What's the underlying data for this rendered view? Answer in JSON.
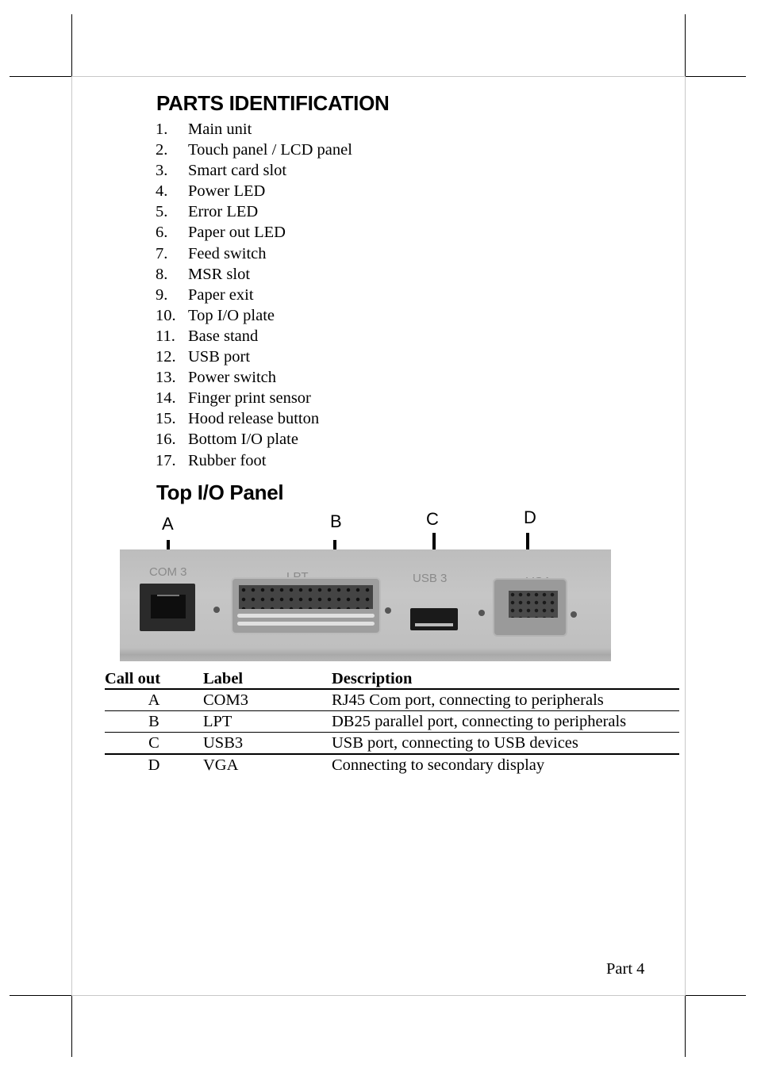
{
  "heading": "PARTS IDENTIFICATION",
  "parts": [
    {
      "num": "1.",
      "name": "Main unit"
    },
    {
      "num": "2.",
      "name": "Touch panel / LCD panel"
    },
    {
      "num": "3.",
      "name": "Smart card slot"
    },
    {
      "num": "4.",
      "name": "Power LED"
    },
    {
      "num": "5.",
      "name": "Error LED"
    },
    {
      "num": "6.",
      "name": "Paper out LED"
    },
    {
      "num": "7.",
      "name": "Feed switch"
    },
    {
      "num": "8.",
      "name": "MSR slot"
    },
    {
      "num": "9.",
      "name": "Paper exit"
    },
    {
      "num": "10.",
      "name": "Top I/O plate"
    },
    {
      "num": "11.",
      "name": "Base stand"
    },
    {
      "num": "12.",
      "name": "USB port"
    },
    {
      "num": "13.",
      "name": "Power switch"
    },
    {
      "num": "14.",
      "name": "Finger print sensor"
    },
    {
      "num": "15.",
      "name": "Hood release button"
    },
    {
      "num": "16.",
      "name": "Bottom I/O plate"
    },
    {
      "num": "17.",
      "name": "Rubber foot"
    }
  ],
  "io_panel": {
    "heading": "Top I/O Panel",
    "callouts": [
      "A",
      "B",
      "C",
      "D"
    ],
    "photo_labels": {
      "com": "COM 3",
      "lpt": "LPT",
      "usb": "USB 3",
      "vga": "VGA"
    }
  },
  "table": {
    "headers": [
      "Call out",
      "Label",
      "Description"
    ],
    "rows": [
      {
        "callout": "A",
        "label": "COM3",
        "description": "RJ45 Com port, connecting to peripherals"
      },
      {
        "callout": "B",
        "label": "LPT",
        "description": "DB25 parallel port, connecting to peripherals"
      },
      {
        "callout": "C",
        "label": "USB3",
        "description": "USB port, connecting to USB devices"
      },
      {
        "callout": "D",
        "label": "VGA",
        "description": "Connecting to secondary display"
      }
    ]
  },
  "footer": "Part 4"
}
